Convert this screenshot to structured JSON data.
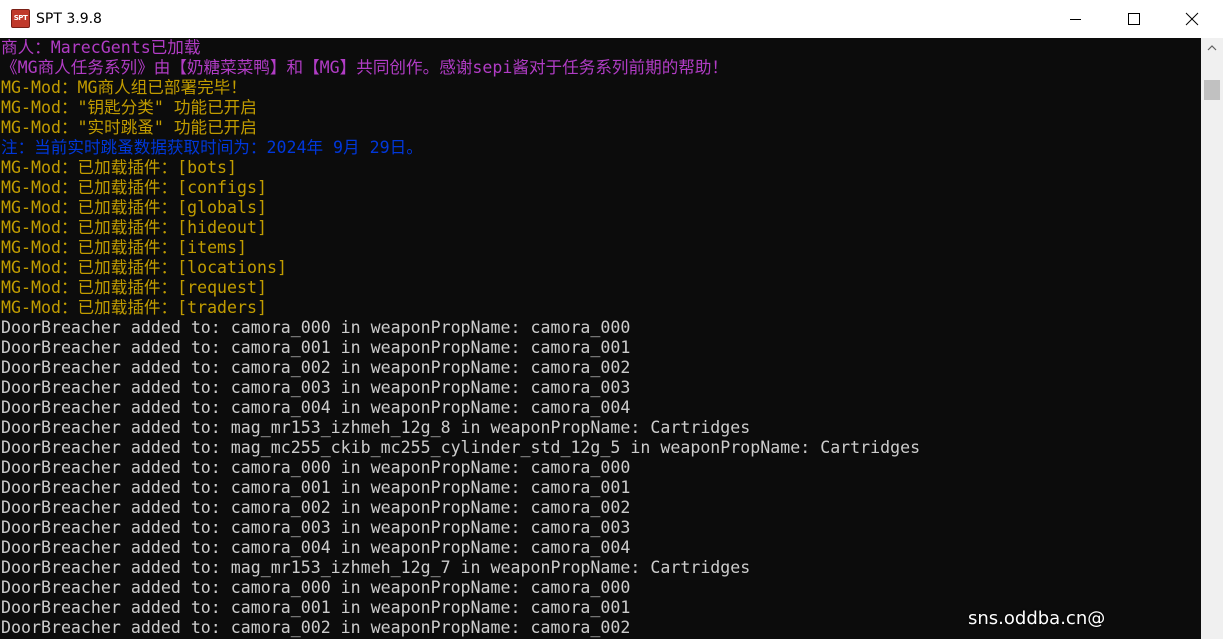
{
  "window": {
    "title": "SPT 3.9.8",
    "icon_text": "SPT",
    "controls": {
      "minimize": "minimize",
      "maximize": "maximize",
      "close": "close"
    }
  },
  "colors": {
    "background": "#0c0c0c",
    "purple": "#b13cc5",
    "yellow": "#c19c00",
    "blue": "#0037da",
    "gray": "#cccccc"
  },
  "console": {
    "lines": [
      {
        "text": "商人：MarecGents已加载",
        "color": "purple"
      },
      {
        "text": "《MG商人任务系列》由【奶糖菜菜鸭】和【MG】共同创作。感谢sepi酱对于任务系列前期的帮助！",
        "color": "purple"
      },
      {
        "text": "MG-Mod：MG商人组已部署完毕！",
        "color": "yellow"
      },
      {
        "text": "MG-Mod：\"钥匙分类\" 功能已开启",
        "color": "yellow"
      },
      {
        "text": "MG-Mod：\"实时跳蚤\" 功能已开启",
        "color": "yellow"
      },
      {
        "text": "注：当前实时跳蚤数据获取时间为：2024年 9月 29日。",
        "color": "blue"
      },
      {
        "text": "MG-Mod：已加载插件：[bots]",
        "color": "yellow"
      },
      {
        "text": "MG-Mod：已加载插件：[configs]",
        "color": "yellow"
      },
      {
        "text": "MG-Mod：已加载插件：[globals]",
        "color": "yellow"
      },
      {
        "text": "MG-Mod：已加载插件：[hideout]",
        "color": "yellow"
      },
      {
        "text": "MG-Mod：已加载插件：[items]",
        "color": "yellow"
      },
      {
        "text": "MG-Mod：已加载插件：[locations]",
        "color": "yellow"
      },
      {
        "text": "MG-Mod：已加载插件：[request]",
        "color": "yellow"
      },
      {
        "text": "MG-Mod：已加载插件：[traders]",
        "color": "yellow"
      },
      {
        "text": "DoorBreacher added to: camora_000 in weaponPropName: camora_000",
        "color": "gray"
      },
      {
        "text": "DoorBreacher added to: camora_001 in weaponPropName: camora_001",
        "color": "gray"
      },
      {
        "text": "DoorBreacher added to: camora_002 in weaponPropName: camora_002",
        "color": "gray"
      },
      {
        "text": "DoorBreacher added to: camora_003 in weaponPropName: camora_003",
        "color": "gray"
      },
      {
        "text": "DoorBreacher added to: camora_004 in weaponPropName: camora_004",
        "color": "gray"
      },
      {
        "text": "DoorBreacher added to: mag_mr153_izhmeh_12g_8 in weaponPropName: Cartridges",
        "color": "gray"
      },
      {
        "text": "DoorBreacher added to: mag_mc255_ckib_mc255_cylinder_std_12g_5 in weaponPropName: Cartridges",
        "color": "gray"
      },
      {
        "text": "DoorBreacher added to: camora_000 in weaponPropName: camora_000",
        "color": "gray"
      },
      {
        "text": "DoorBreacher added to: camora_001 in weaponPropName: camora_001",
        "color": "gray"
      },
      {
        "text": "DoorBreacher added to: camora_002 in weaponPropName: camora_002",
        "color": "gray"
      },
      {
        "text": "DoorBreacher added to: camora_003 in weaponPropName: camora_003",
        "color": "gray"
      },
      {
        "text": "DoorBreacher added to: camora_004 in weaponPropName: camora_004",
        "color": "gray"
      },
      {
        "text": "DoorBreacher added to: mag_mr153_izhmeh_12g_7 in weaponPropName: Cartridges",
        "color": "gray"
      },
      {
        "text": "DoorBreacher added to: camora_000 in weaponPropName: camora_000",
        "color": "gray"
      },
      {
        "text": "DoorBreacher added to: camora_001 in weaponPropName: camora_001",
        "color": "gray"
      },
      {
        "text": "DoorBreacher added to: camora_002 in weaponPropName: camora_002",
        "color": "gray"
      }
    ]
  },
  "watermark": {
    "text": "sns.oddba.cn@"
  }
}
